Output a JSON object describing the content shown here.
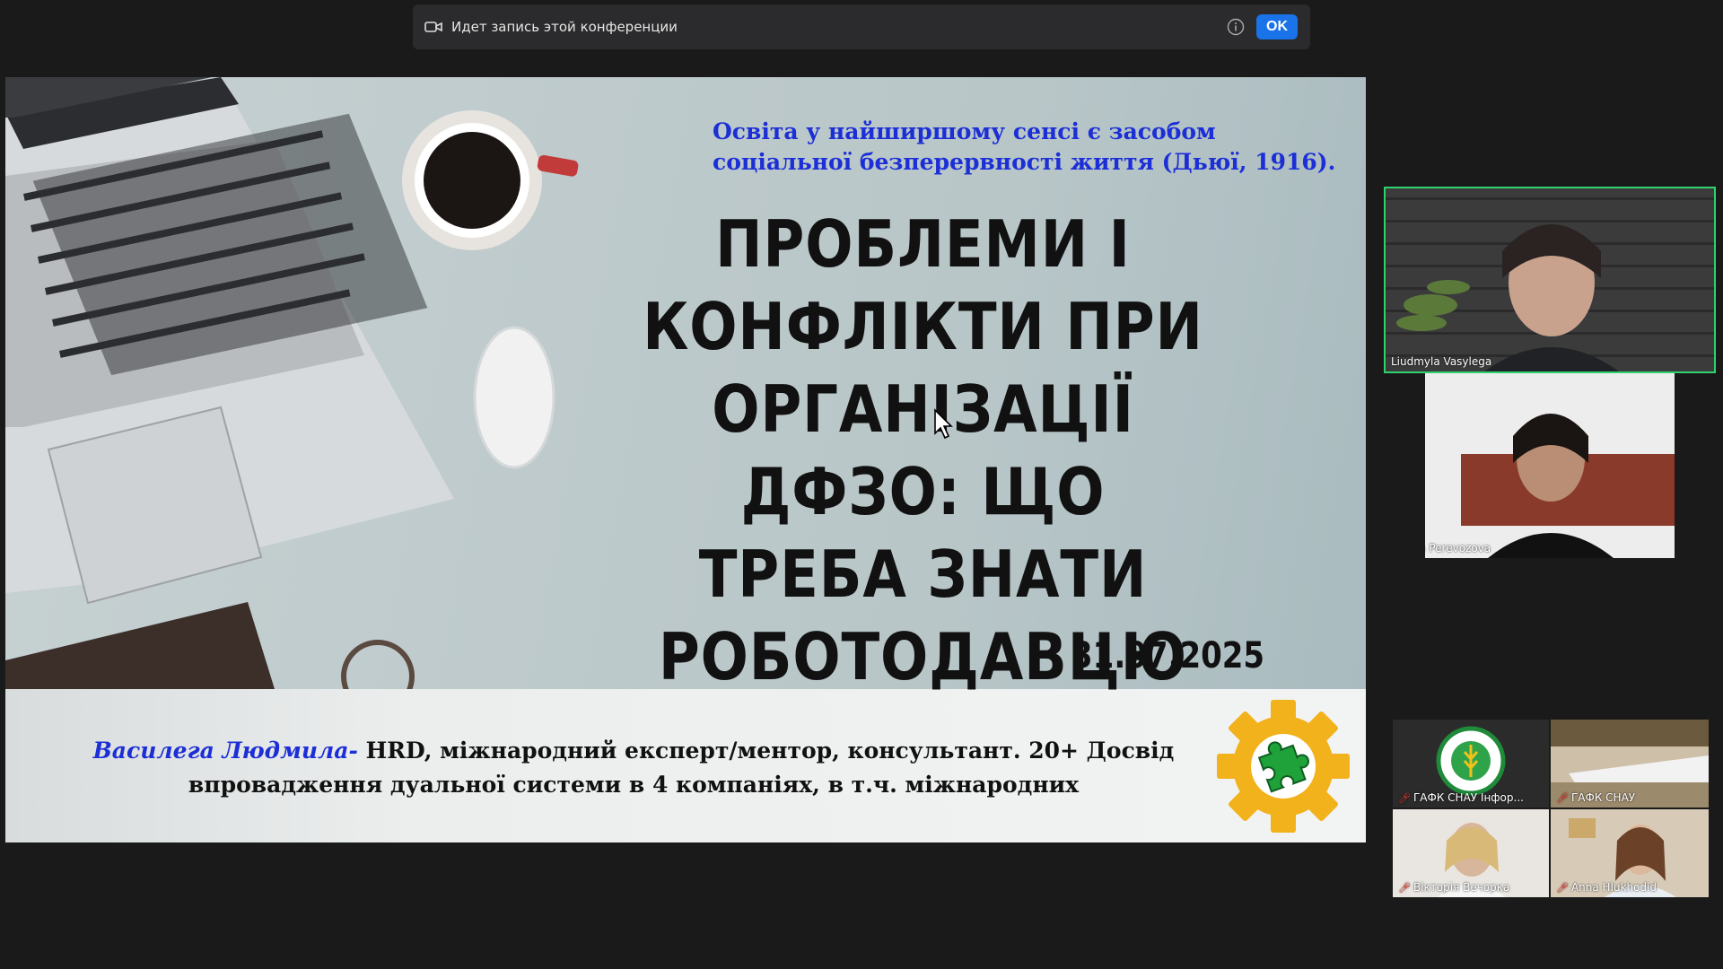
{
  "recording_bar": {
    "text": "Идет запись этой конференции",
    "ok_label": "OK"
  },
  "slide": {
    "quote": "Освіта у найширшому сенсі є засобом соціальної безперервності життя (Дьюї, 1916).",
    "title_lines": [
      "ПРОБЛЕМИ І",
      "КОНФЛІКТИ ПРИ",
      "ОРГАНІЗАЦІЇ ДФЗО: ЩО",
      "ТРЕБА ЗНАТИ",
      "РОБОТОДАВЦЮ"
    ],
    "date": "31.07.2025",
    "author_name": "Василега Людмила-",
    "author_desc_1": " HRD, міжнародний експерт/ментор, консультант. 20+ Досвід",
    "author_desc_2": "впровадження дуальної системи в 4 компаніях, в т.ч. міжнародних"
  },
  "participants": {
    "speaker_1": "Liudmyla Vasylega",
    "speaker_2": "Iryna Perevozova",
    "grid": [
      {
        "name": "ГАФК СНАУ Інфор..."
      },
      {
        "name": "ГАФК СНАУ"
      },
      {
        "name": "Вікторія Вечорка"
      },
      {
        "name": "Anna Hlukhodid"
      }
    ]
  },
  "colors": {
    "accent_blue": "#1c2fd6",
    "ok_button": "#1a73e8",
    "active_speaker_border": "#2fd36b"
  }
}
